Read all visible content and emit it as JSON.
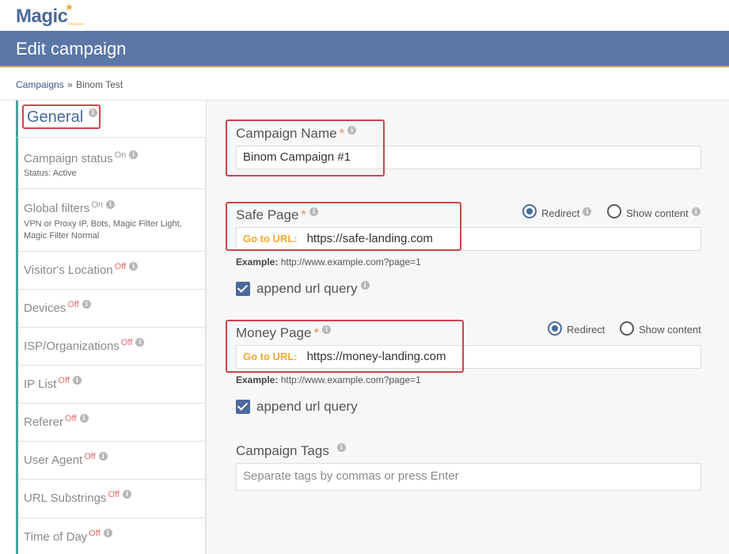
{
  "logo": {
    "text_a": "Mag",
    "text_b": "ic",
    "sub": "Checker"
  },
  "header": {
    "title": "Edit campaign"
  },
  "breadcrumb": {
    "root": "Campaigns",
    "sep": "»",
    "current": "Binom Test"
  },
  "sidebar": {
    "general": "General",
    "items": [
      {
        "label": "Campaign status",
        "state": "On",
        "sub1": "Status: Active",
        "sub2": ""
      },
      {
        "label": "Global filters",
        "state": "On",
        "sub1": "VPN or Proxy IP, Bots, Magic Filter Light,",
        "sub2": "Magic Filter Normal"
      },
      {
        "label": "Visitor's Location",
        "state": "Off"
      },
      {
        "label": "Devices",
        "state": "Off"
      },
      {
        "label": "ISP/Organizations",
        "state": "Off"
      },
      {
        "label": "IP List",
        "state": "Off"
      },
      {
        "label": "Referer",
        "state": "Off"
      },
      {
        "label": "User Agent",
        "state": "Off"
      },
      {
        "label": "URL Substrings",
        "state": "Off"
      },
      {
        "label": "Time of Day",
        "state": "Off"
      }
    ]
  },
  "form": {
    "campaign_name": {
      "label": "Campaign Name",
      "required": "*",
      "value": "Binom Campaign #1"
    },
    "safe_page": {
      "label": "Safe Page",
      "required": "*",
      "prefix": "Go to URL:",
      "value": "https://safe-landing.com",
      "example_label": "Example:",
      "example_value": "http://www.example.com?page=1",
      "append_label": "append url query",
      "radio_redirect": "Redirect",
      "radio_show": "Show content"
    },
    "money_page": {
      "label": "Money Page",
      "required": "*",
      "prefix": "Go to URL:",
      "value": "https://money-landing.com",
      "example_label": "Example:",
      "example_value": "http://www.example.com?page=1",
      "append_label": "append url query",
      "radio_redirect": "Redirect",
      "radio_show": "Show content"
    },
    "tags": {
      "label": "Campaign Tags",
      "placeholder": "Separate tags by commas or press Enter"
    }
  },
  "colors": {
    "header": "#5a77a6",
    "accent": "#4aa29b",
    "highlight": "#c9464c",
    "off": "#e26a6a",
    "url_prefix": "#f2a82c"
  }
}
